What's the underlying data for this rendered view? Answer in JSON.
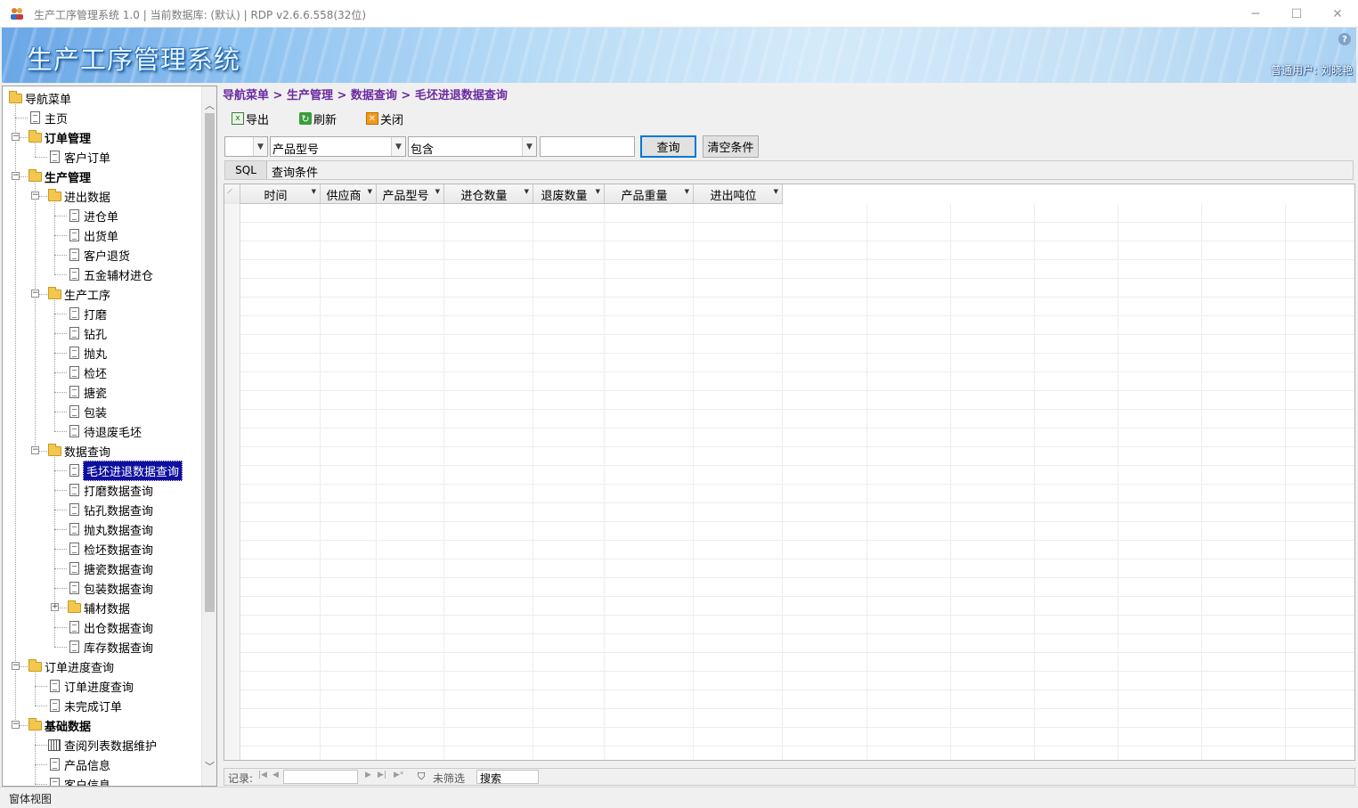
{
  "window": {
    "title": "生产工序管理系统 1.0 | 当前数据库: (默认) | RDP v2.6.6.558(32位)",
    "buttons": {
      "minimize": "─",
      "maximize": "☐",
      "close": "✕"
    }
  },
  "banner": {
    "app_title": "生产工序管理系统",
    "help": "?",
    "user": "普通用户: 刘晓艳"
  },
  "nav": {
    "items": [
      {
        "label": "导航菜单",
        "icon": "folder-open-icon",
        "level": 0,
        "bold": false
      },
      {
        "label": "主页",
        "icon": "document-icon",
        "level": 1,
        "bold": false
      },
      {
        "label": "订单管理",
        "icon": "folder-open-icon",
        "level": 1,
        "bold": true,
        "expanded": true
      },
      {
        "label": "客户订单",
        "icon": "document-icon",
        "level": 2,
        "bold": false
      },
      {
        "label": "生产管理",
        "icon": "folder-open-icon",
        "level": 1,
        "bold": true,
        "expanded": true
      },
      {
        "label": "进出数据",
        "icon": "folder-open-icon",
        "level": 2,
        "bold": false,
        "expanded": true
      },
      {
        "label": "进仓单",
        "icon": "document-icon",
        "level": 3,
        "bold": false
      },
      {
        "label": "出货单",
        "icon": "document-icon",
        "level": 3,
        "bold": false
      },
      {
        "label": "客户退货",
        "icon": "document-icon",
        "level": 3,
        "bold": false
      },
      {
        "label": "五金辅材进仓",
        "icon": "document-icon",
        "level": 3,
        "bold": false
      },
      {
        "label": "生产工序",
        "icon": "folder-open-icon",
        "level": 2,
        "bold": false,
        "expanded": true
      },
      {
        "label": "打磨",
        "icon": "document-icon",
        "level": 3,
        "bold": false
      },
      {
        "label": "钻孔",
        "icon": "document-icon",
        "level": 3,
        "bold": false
      },
      {
        "label": "抛丸",
        "icon": "document-icon",
        "level": 3,
        "bold": false
      },
      {
        "label": "检坯",
        "icon": "document-icon",
        "level": 3,
        "bold": false
      },
      {
        "label": "搪瓷",
        "icon": "document-icon",
        "level": 3,
        "bold": false
      },
      {
        "label": "包装",
        "icon": "document-icon",
        "level": 3,
        "bold": false
      },
      {
        "label": "待退废毛坯",
        "icon": "document-icon",
        "level": 3,
        "bold": false
      },
      {
        "label": "数据查询",
        "icon": "folder-open-icon",
        "level": 2,
        "bold": false,
        "expanded": true
      },
      {
        "label": "毛坯进退数据查询",
        "icon": "document-icon",
        "level": 3,
        "bold": false,
        "selected": true
      },
      {
        "label": "打磨数据查询",
        "icon": "document-icon",
        "level": 3,
        "bold": false
      },
      {
        "label": "钻孔数据查询",
        "icon": "document-icon",
        "level": 3,
        "bold": false
      },
      {
        "label": "抛丸数据查询",
        "icon": "document-icon",
        "level": 3,
        "bold": false
      },
      {
        "label": "检坯数据查询",
        "icon": "document-icon",
        "level": 3,
        "bold": false
      },
      {
        "label": "搪瓷数据查询",
        "icon": "document-icon",
        "level": 3,
        "bold": false
      },
      {
        "label": "包装数据查询",
        "icon": "document-icon",
        "level": 3,
        "bold": false
      },
      {
        "label": "辅材数据",
        "icon": "folder-open-icon",
        "level": 3,
        "bold": false,
        "expanded": false
      },
      {
        "label": "出仓数据查询",
        "icon": "document-icon",
        "level": 3,
        "bold": false
      },
      {
        "label": "库存数据查询",
        "icon": "document-icon",
        "level": 3,
        "bold": false
      },
      {
        "label": "订单进度查询",
        "icon": "folder-open-icon",
        "level": 1,
        "bold": false,
        "expanded": true
      },
      {
        "label": "订单进度查询",
        "icon": "document-icon",
        "level": 2,
        "bold": false
      },
      {
        "label": "未完成订单",
        "icon": "document-icon",
        "level": 2,
        "bold": false
      },
      {
        "label": "基础数据",
        "icon": "folder-open-icon",
        "level": 1,
        "bold": true,
        "expanded": true
      },
      {
        "label": "查阅列表数据维护",
        "icon": "grid-icon",
        "level": 2,
        "bold": false
      },
      {
        "label": "产品信息",
        "icon": "document-icon",
        "level": 2,
        "bold": false
      },
      {
        "label": "客户信息",
        "icon": "document-icon",
        "level": 2,
        "bold": false
      }
    ]
  },
  "breadcrumb": "导航菜单 > 生产管理 > 数据查询 > 毛坯进退数据查询",
  "toolbar": {
    "export_label": "导出",
    "refresh_label": "刷新",
    "close_label": "关闭"
  },
  "filter": {
    "logic_value": "",
    "field_value": "产品型号",
    "operator_value": "包含",
    "query_value": "",
    "query_button": "查询",
    "clear_button": "清空条件"
  },
  "sql": {
    "button": "SQL",
    "text": "查询条件"
  },
  "grid": {
    "columns": [
      "时间",
      "供应商",
      "产品型号",
      "进仓数量",
      "退废数量",
      "产品重量",
      "进出吨位"
    ],
    "rows": []
  },
  "navbar": {
    "record_label": "记录:",
    "record_value": "",
    "filter_label": "未筛选",
    "search_label": "搜索"
  },
  "status": {
    "text": "窗体视图"
  },
  "colors": {
    "breadcrumb": "#6b2aa0",
    "selection": "#1010a0",
    "default_button_border": "#0078d7"
  }
}
